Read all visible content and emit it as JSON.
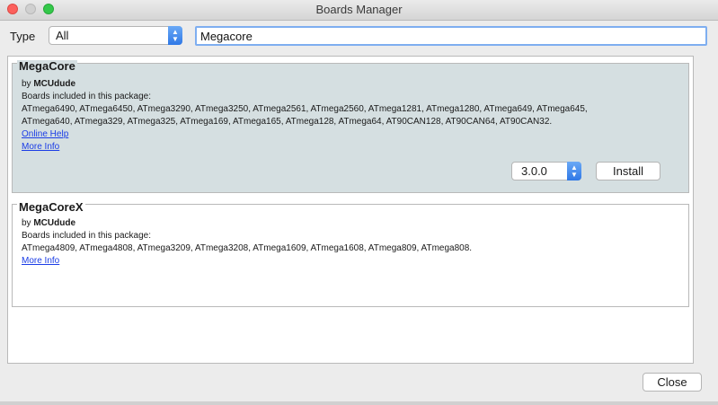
{
  "window": {
    "title": "Boards Manager"
  },
  "filter": {
    "type_label": "Type",
    "type_value": "All",
    "search_value": "Megacore"
  },
  "packages": [
    {
      "name": "MegaCore",
      "by_prefix": "by ",
      "author": "MCUdude",
      "boards_intro": "Boards included in this package:",
      "boards_line1": "ATmega6490, ATmega6450, ATmega3290, ATmega3250, ATmega2561, ATmega2560, ATmega1281, ATmega1280, ATmega649, ATmega645,",
      "boards_line2": "ATmega640, ATmega329, ATmega325, ATmega169, ATmega165, ATmega128, ATmega64, AT90CAN128, AT90CAN64, AT90CAN32.",
      "online_help": "Online Help",
      "more_info": "More Info",
      "version": "3.0.0",
      "install_label": "Install"
    },
    {
      "name": "MegaCoreX",
      "by_prefix": "by ",
      "author": "MCUdude",
      "boards_intro": "Boards included in this package:",
      "boards_line1": "ATmega4809, ATmega4808, ATmega3209, ATmega3208, ATmega1609, ATmega1608, ATmega809, ATmega808.",
      "more_info": "More Info"
    }
  ],
  "footer": {
    "close_label": "Close"
  }
}
